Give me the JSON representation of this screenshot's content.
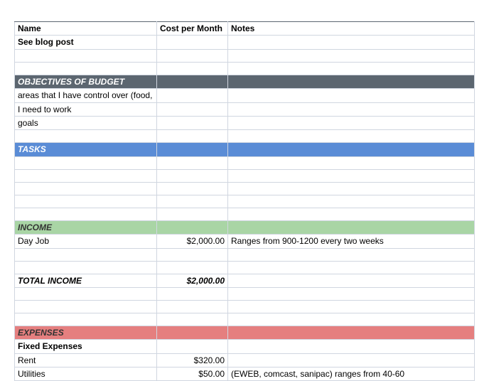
{
  "headers": {
    "name": "Name",
    "cost": "Cost per Month",
    "notes": "Notes"
  },
  "intro": {
    "see_blog": "See blog post"
  },
  "sections": {
    "objectives": "OBJECTIVES OF BUDGET",
    "tasks": "TASKS",
    "income": "INCOME",
    "expenses": "EXPENSES"
  },
  "objectives": {
    "line1": "areas that I have control over (food,",
    "line2": "I need to work",
    "line3": "goals"
  },
  "income": {
    "dayjob": {
      "name": "Day Job",
      "amount": "$2,000.00",
      "notes": "Ranges from 900-1200 every two weeks"
    },
    "total": {
      "name": "TOTAL INCOME",
      "amount": "$2,000.00"
    }
  },
  "expenses": {
    "fixed": "Fixed Expenses",
    "rent": {
      "name": "Rent",
      "amount": "$320.00"
    },
    "utilities": {
      "name": "Utilities",
      "amount": "$50.00",
      "notes": "(EWEB, comcast, sanipac) ranges from 40-60"
    }
  }
}
